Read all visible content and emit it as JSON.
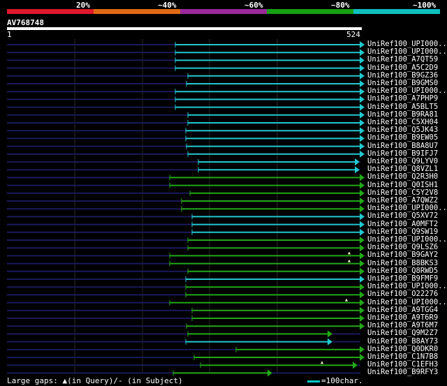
{
  "legend": [
    {
      "label": "20%",
      "color": "#e0182c"
    },
    {
      "label": "~40%",
      "color": "#e06a14"
    },
    {
      "label": "~60%",
      "color": "#9a2a9a"
    },
    {
      "label": "~80%",
      "color": "#16a014"
    },
    {
      "label": "~100%",
      "color": "#10c0c0"
    }
  ],
  "query": {
    "name": "AV768748",
    "start": "1",
    "end": "524"
  },
  "colors": {
    "cyan": "#22c8d0",
    "green": "#22a818",
    "navy": "#1a1a5c",
    "grid": "#2a2a2a"
  },
  "hits": [
    {
      "label": "UniRef100_UPI000..",
      "s": 251,
      "e": 516,
      "c": "cyan",
      "gap": null
    },
    {
      "label": "UniRef100_UPI000..",
      "s": 251,
      "e": 516,
      "c": "cyan",
      "gap": null
    },
    {
      "label": "UniRef100_A7QT59",
      "s": 251,
      "e": 516,
      "c": "cyan",
      "gap": null
    },
    {
      "label": "UniRef100_A5C2D9",
      "s": 251,
      "e": 516,
      "c": "cyan",
      "gap": null
    },
    {
      "label": "UniRef100_B9GZ36",
      "s": 269,
      "e": 516,
      "c": "cyan",
      "gap": null
    },
    {
      "label": "UniRef100_B9GMS0",
      "s": 267,
      "e": 516,
      "c": "cyan",
      "gap": null
    },
    {
      "label": "UniRef100_UPI000..",
      "s": 251,
      "e": 516,
      "c": "cyan",
      "gap": null
    },
    {
      "label": "UniRef100_A7PHP9",
      "s": 251,
      "e": 516,
      "c": "cyan",
      "gap": null
    },
    {
      "label": "UniRef100_A5BLT5",
      "s": 251,
      "e": 516,
      "c": "cyan",
      "gap": null
    },
    {
      "label": "UniRef100_B9RA81",
      "s": 269,
      "e": 516,
      "c": "cyan",
      "gap": null
    },
    {
      "label": "UniRef100_C5XH04",
      "s": 269,
      "e": 516,
      "c": "cyan",
      "gap": null
    },
    {
      "label": "UniRef100_Q5JK43",
      "s": 266,
      "e": 516,
      "c": "cyan",
      "gap": null
    },
    {
      "label": "UniRef100_B9EW05",
      "s": 266,
      "e": 516,
      "c": "cyan",
      "gap": null
    },
    {
      "label": "UniRef100_B8A8U7",
      "s": 267,
      "e": 516,
      "c": "cyan",
      "gap": null
    },
    {
      "label": "UniRef100_B9IFJ7",
      "s": 269,
      "e": 516,
      "c": "cyan",
      "gap": null
    },
    {
      "label": "UniRef100_Q9LYV0",
      "s": 284,
      "e": 509,
      "c": "cyan",
      "gap": null
    },
    {
      "label": "UniRef100_Q8VZL1",
      "s": 284,
      "e": 509,
      "c": "cyan",
      "gap": null
    },
    {
      "label": "UniRef100_Q2R3H0",
      "s": 243,
      "e": 516,
      "c": "green",
      "gap": null
    },
    {
      "label": "UniRef100_Q0ISH1",
      "s": 243,
      "e": 516,
      "c": "green",
      "gap": null
    },
    {
      "label": "UniRef100_C5Y2V8",
      "s": 272,
      "e": 516,
      "c": "green",
      "gap": null
    },
    {
      "label": "UniRef100_A7QWZ2",
      "s": 260,
      "e": 516,
      "c": "green",
      "gap": null
    },
    {
      "label": "UniRef100_UPI000..",
      "s": 260,
      "e": 516,
      "c": "green",
      "gap": null
    },
    {
      "label": "UniRef100_Q5XV72",
      "s": 275,
      "e": 516,
      "c": "cyan",
      "gap": null
    },
    {
      "label": "UniRef100_A0MFT2",
      "s": 275,
      "e": 516,
      "c": "cyan",
      "gap": null
    },
    {
      "label": "UniRef100_Q9SW19",
      "s": 275,
      "e": 516,
      "c": "cyan",
      "gap": null
    },
    {
      "label": "UniRef100_UPI000..",
      "s": 269,
      "e": 516,
      "c": "green",
      "gap": null
    },
    {
      "label": "UniRef100_Q9LSZ6",
      "s": 269,
      "e": 516,
      "c": "green",
      "gap": null
    },
    {
      "label": "UniRef100_B9GAY2",
      "s": 243,
      "e": 516,
      "c": "green",
      "gap": 500
    },
    {
      "label": "UniRef100_B8BKS3",
      "s": 243,
      "e": 516,
      "c": "green",
      "gap": 500
    },
    {
      "label": "UniRef100_Q8RWD5",
      "s": 269,
      "e": 516,
      "c": "green",
      "gap": null
    },
    {
      "label": "UniRef100_B9FMF9",
      "s": 266,
      "e": 516,
      "c": "cyan",
      "gap": null
    },
    {
      "label": "UniRef100_UPI000..",
      "s": 266,
      "e": 516,
      "c": "green",
      "gap": null
    },
    {
      "label": "UniRef100_O22276",
      "s": 266,
      "e": 516,
      "c": "green",
      "gap": null
    },
    {
      "label": "UniRef100_UPI000..",
      "s": 243,
      "e": 516,
      "c": "green",
      "gap": 496
    },
    {
      "label": "UniRef100_A9TGG4",
      "s": 275,
      "e": 516,
      "c": "green",
      "gap": null
    },
    {
      "label": "UniRef100_A9T6R9",
      "s": 275,
      "e": 516,
      "c": "green",
      "gap": null
    },
    {
      "label": "UniRef100_A9T6M7",
      "s": 267,
      "e": 516,
      "c": "green",
      "gap": null
    },
    {
      "label": "UniRef100_Q9M2Z7",
      "s": 269,
      "e": 470,
      "c": "green",
      "gap": null
    },
    {
      "label": "UniRef100_B8AY73",
      "s": 266,
      "e": 470,
      "c": "cyan",
      "gap": null
    },
    {
      "label": "UniRef100_Q0DKR0",
      "s": 338,
      "e": 516,
      "c": "green",
      "gap": null
    },
    {
      "label": "UniRef100_C1N7B8",
      "s": 278,
      "e": 516,
      "c": "green",
      "gap": null
    },
    {
      "label": "UniRef100_C1EFH3",
      "s": 287,
      "e": 506,
      "c": "green",
      "gap": 461
    },
    {
      "label": "UniRef100_B9RFY3",
      "s": 248,
      "e": 384,
      "c": "green",
      "gap": null
    }
  ],
  "footer": {
    "gaps_text": "Large gaps: ▲(in Query)/- (in Subject)",
    "scale_text": "=100char."
  }
}
